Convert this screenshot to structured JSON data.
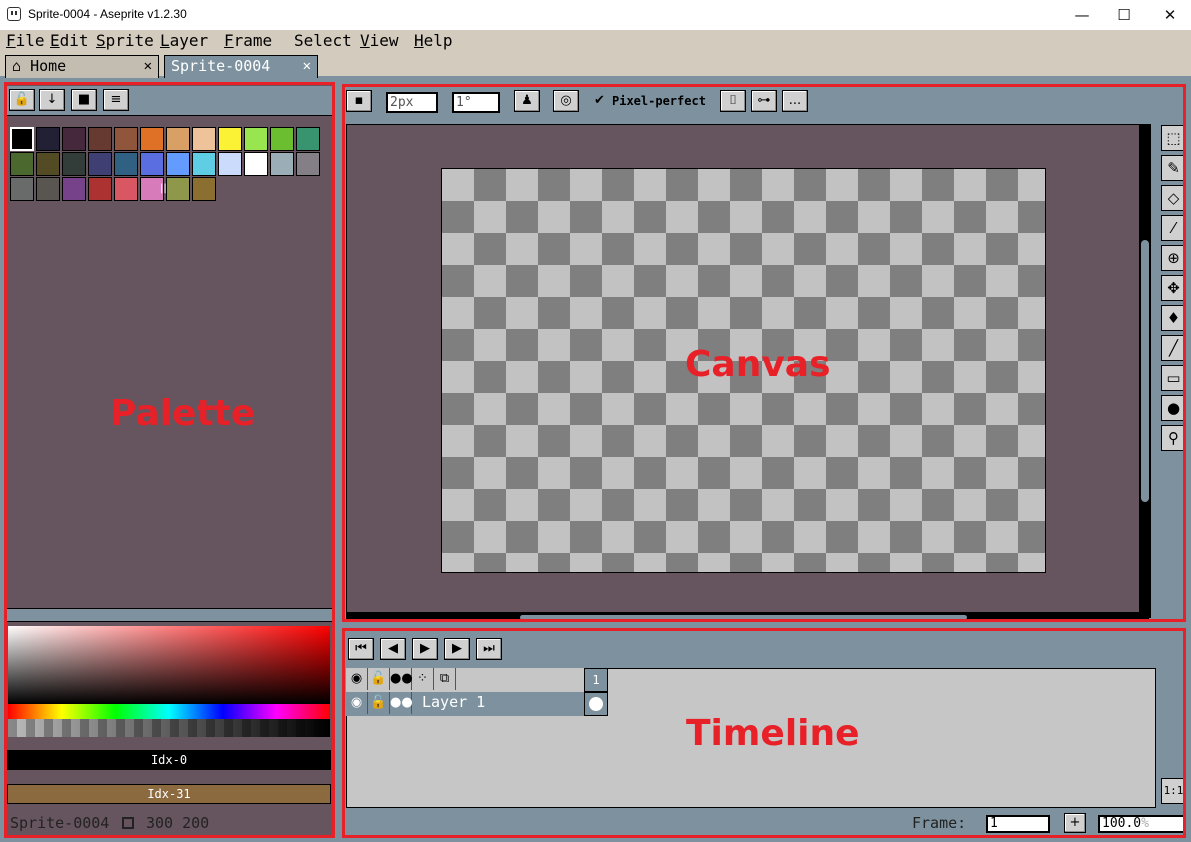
{
  "window": {
    "title": "Sprite-0004 - Aseprite v1.2.30",
    "minimize_glyph": "—",
    "maximize_glyph": "☐",
    "close_glyph": "✕"
  },
  "menu": {
    "items": [
      {
        "underline": "F",
        "rest": "ile"
      },
      {
        "underline": "E",
        "rest": "dit"
      },
      {
        "underline": "S",
        "rest": "prite"
      },
      {
        "underline": "L",
        "rest": "ayer"
      },
      {
        "underline": "F",
        "rest": "rame"
      },
      {
        "underline": "",
        "rest": "Select"
      },
      {
        "underline": "V",
        "rest": "iew"
      },
      {
        "underline": "H",
        "rest": "elp"
      }
    ]
  },
  "tabs": {
    "home": "Home",
    "sprite": "Sprite-0004",
    "close": "✕"
  },
  "palette": {
    "colors": [
      "#000000",
      "#222034",
      "#45283c",
      "#663931",
      "#8f563b",
      "#df7126",
      "#d9a066",
      "#eec39a",
      "#fbf236",
      "#99e550",
      "#6abe30",
      "#37946e",
      "#4b692f",
      "#524b24",
      "#323c39",
      "#3f3f74",
      "#306082",
      "#5b6ee1",
      "#639bff",
      "#5fcde4",
      "#cbdbfc",
      "#ffffff",
      "#9badb7",
      "#847e87",
      "#696a6a",
      "#595652",
      "#76428a",
      "#ac3232",
      "#d95763",
      "#d77bba",
      "#8f974a",
      "#8a6f30"
    ],
    "fg_index": "Idx-0",
    "bg_index": "Idx-31",
    "fg_color": "#000000",
    "bg_color": "#8c6a3f"
  },
  "status": {
    "sprite_name": "Sprite-0004",
    "size": "300 200"
  },
  "context_bar": {
    "brush_size": "2px",
    "brush_angle": "1°",
    "pixel_perfect": "Pixel-perfect",
    "more": "..."
  },
  "timeline": {
    "layer_name": "Layer 1",
    "frame_number": "1",
    "frame_label": "Frame:",
    "frame_value": "1",
    "zoom_value": "100.0",
    "zoom_unit": "%",
    "zoom_11": "1:1"
  },
  "annotations": {
    "palette": "Palette",
    "canvas": "Canvas",
    "timeline": "Timeline"
  }
}
